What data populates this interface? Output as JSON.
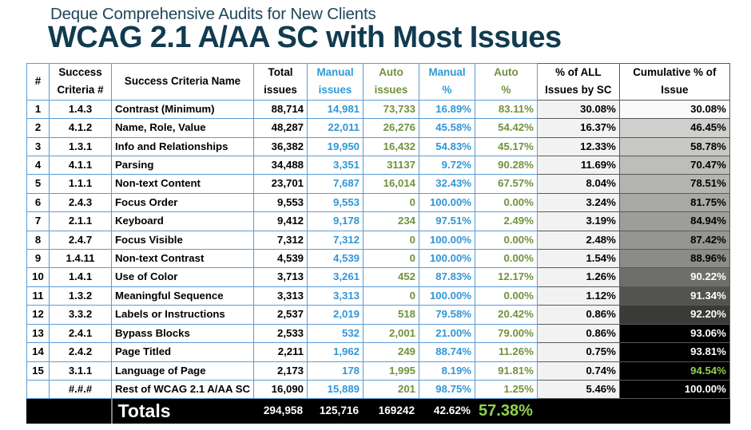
{
  "title": {
    "subtitle": "Deque Comprehensive Audits for New Clients",
    "main": "WCAG 2.1 A/AA SC with Most Issues"
  },
  "colors": {
    "title_navy": "#113b4f",
    "manual_blue": "#3196d4",
    "auto_green": "#71913d",
    "highlight_green": "#92d050",
    "grid_blue": "#5b9bd5",
    "grid_dark": "#595959"
  },
  "table": {
    "headers": [
      "#",
      "Success Criteria #",
      "Success Criteria Name",
      "Total issues",
      "Manual issues",
      "Auto issues",
      "Manual %",
      "Auto %",
      "% of ALL Issues by SC",
      "Cumulative % of Issue"
    ],
    "header_lines": [
      [
        "#",
        ""
      ],
      [
        "Success",
        "Criteria #"
      ],
      [
        "Success Criteria Name",
        ""
      ],
      [
        "Total",
        "issues"
      ],
      [
        "Manual",
        "issues"
      ],
      [
        "Auto",
        "issues"
      ],
      [
        "Manual",
        "%"
      ],
      [
        "Auto",
        "%"
      ],
      [
        "% of ALL",
        "Issues by SC"
      ],
      [
        "Cumulative % of",
        "Issue"
      ]
    ],
    "rows": [
      {
        "num": "1",
        "sc": "1.4.3",
        "name": "Contrast (Minimum)",
        "total": "88,714",
        "manual": "14,981",
        "auto": "73,733",
        "manual_pct": "16.89%",
        "auto_pct": "83.11%",
        "pct_all": "30.08%",
        "cumulative": "30.08%",
        "cum_bg": "#fafafa",
        "cum_text": "dark"
      },
      {
        "num": "2",
        "sc": "4.1.2",
        "name": "Name, Role, Value",
        "total": "48,287",
        "manual": "22,011",
        "auto": "26,276",
        "manual_pct": "45.58%",
        "auto_pct": "54.42%",
        "pct_all": "16.37%",
        "cumulative": "46.45%",
        "cum_bg": "#cfcfcd",
        "cum_text": "dark"
      },
      {
        "num": "3",
        "sc": "1.3.1",
        "name": "Info and Relationships",
        "total": "36,382",
        "manual": "19,950",
        "auto": "16,432",
        "manual_pct": "54.83%",
        "auto_pct": "45.17%",
        "pct_all": "12.33%",
        "cumulative": "58.78%",
        "cum_bg": "#c8c8c4",
        "cum_text": "dark"
      },
      {
        "num": "4",
        "sc": "4.1.1",
        "name": "Parsing",
        "total": "34,488",
        "manual": "3,351",
        "auto": "31137",
        "manual_pct": "9.72%",
        "auto_pct": "90.28%",
        "pct_all": "11.69%",
        "cumulative": "70.47%",
        "cum_bg": "#bdbdb9",
        "cum_text": "dark"
      },
      {
        "num": "5",
        "sc": "1.1.1",
        "name": "Non-text Content",
        "total": "23,701",
        "manual": "7,687",
        "auto": "16,014",
        "manual_pct": "32.43%",
        "auto_pct": "67.57%",
        "pct_all": "8.04%",
        "cumulative": "78.51%",
        "cum_bg": "#b4b4b0",
        "cum_text": "dark"
      },
      {
        "num": "6",
        "sc": "2.4.3",
        "name": "Focus Order",
        "total": "9,553",
        "manual": "9,553",
        "auto": "0",
        "manual_pct": "100.00%",
        "auto_pct": "0.00%",
        "pct_all": "3.24%",
        "cumulative": "81.75%",
        "cum_bg": "#a8a8a4",
        "cum_text": "dark"
      },
      {
        "num": "7",
        "sc": "2.1.1",
        "name": "Keyboard",
        "total": "9,412",
        "manual": "9,178",
        "auto": "234",
        "manual_pct": "97.51%",
        "auto_pct": "2.49%",
        "pct_all": "3.19%",
        "cumulative": "84.94%",
        "cum_bg": "#9d9d99",
        "cum_text": "dark"
      },
      {
        "num": "8",
        "sc": "2.4.7",
        "name": "Focus Visible",
        "total": "7,312",
        "manual": "7,312",
        "auto": "0",
        "manual_pct": "100.00%",
        "auto_pct": "0.00%",
        "pct_all": "2.48%",
        "cumulative": "87.42%",
        "cum_bg": "#959591",
        "cum_text": "dark"
      },
      {
        "num": "9",
        "sc": "1.4.11",
        "name": "Non-text Contrast",
        "total": "4,539",
        "manual": "4,539",
        "auto": "0",
        "manual_pct": "100.00%",
        "auto_pct": "0.00%",
        "pct_all": "1.54%",
        "cumulative": "88.96%",
        "cum_bg": "#8b8b87",
        "cum_text": "dark"
      },
      {
        "num": "10",
        "sc": "1.4.1",
        "name": "Use of Color",
        "total": "3,713",
        "manual": "3,261",
        "auto": "452",
        "manual_pct": "87.83%",
        "auto_pct": "12.17%",
        "pct_all": "1.26%",
        "cumulative": "90.22%",
        "cum_bg": "#6e6e6a",
        "cum_text": "white"
      },
      {
        "num": "11",
        "sc": "1.3.2",
        "name": "Meaningful Sequence",
        "total": "3,313",
        "manual": "3,313",
        "auto": "0",
        "manual_pct": "100.00%",
        "auto_pct": "0.00%",
        "pct_all": "1.12%",
        "cumulative": "91.34%",
        "cum_bg": "#53534f",
        "cum_text": "white"
      },
      {
        "num": "12",
        "sc": "3.3.2",
        "name": "Labels or Instructions",
        "total": "2,537",
        "manual": "2,019",
        "auto": "518",
        "manual_pct": "79.58%",
        "auto_pct": "20.42%",
        "pct_all": "0.86%",
        "cumulative": "92.20%",
        "cum_bg": "#3a3a36",
        "cum_text": "white"
      },
      {
        "num": "13",
        "sc": "2.4.1",
        "name": "Bypass Blocks",
        "total": "2,533",
        "manual": "532",
        "auto": "2,001",
        "manual_pct": "21.00%",
        "auto_pct": "79.00%",
        "pct_all": "0.86%",
        "cumulative": "93.06%",
        "cum_bg": "#000000",
        "cum_text": "white"
      },
      {
        "num": "14",
        "sc": "2.4.2",
        "name": "Page Titled",
        "total": "2,211",
        "manual": "1,962",
        "auto": "249",
        "manual_pct": "88.74%",
        "auto_pct": "11.26%",
        "pct_all": "0.75%",
        "cumulative": "93.81%",
        "cum_bg": "#000000",
        "cum_text": "white"
      },
      {
        "num": "15",
        "sc": "3.1.1",
        "name": "Language of Page",
        "total": "2,173",
        "manual": "178",
        "auto": "1,995",
        "manual_pct": "8.19%",
        "auto_pct": "91.81%",
        "pct_all": "0.74%",
        "cumulative": "94.54%",
        "cum_bg": "#000000",
        "cum_text": "green"
      },
      {
        "num": "",
        "sc": "#.#.#",
        "name": "Rest of WCAG 2.1 A/AA SC",
        "total": "16,090",
        "manual": "15,889",
        "auto": "201",
        "manual_pct": "98.75%",
        "auto_pct": "1.25%",
        "pct_all": "5.46%",
        "cumulative": "100.00%",
        "cum_bg": "#000000",
        "cum_text": "white"
      }
    ],
    "totals": {
      "label": "Totals",
      "total": "294,958",
      "manual": "125,716",
      "auto": "169242",
      "manual_pct": "42.62%",
      "auto_pct": "57.38%"
    }
  },
  "chart_data": {
    "type": "table",
    "title": "WCAG 2.1 A/AA SC with Most Issues",
    "subtitle": "Deque Comprehensive Audits for New Clients",
    "columns": [
      "#",
      "Success Criteria #",
      "Success Criteria Name",
      "Total issues",
      "Manual issues",
      "Auto issues",
      "Manual %",
      "Auto %",
      "% of ALL Issues by SC",
      "Cumulative % of Issue"
    ],
    "rows": [
      [
        1,
        "1.4.3",
        "Contrast (Minimum)",
        88714,
        14981,
        73733,
        16.89,
        83.11,
        30.08,
        30.08
      ],
      [
        2,
        "4.1.2",
        "Name, Role, Value",
        48287,
        22011,
        26276,
        45.58,
        54.42,
        16.37,
        46.45
      ],
      [
        3,
        "1.3.1",
        "Info and Relationships",
        36382,
        19950,
        16432,
        54.83,
        45.17,
        12.33,
        58.78
      ],
      [
        4,
        "4.1.1",
        "Parsing",
        34488,
        3351,
        31137,
        9.72,
        90.28,
        11.69,
        70.47
      ],
      [
        5,
        "1.1.1",
        "Non-text Content",
        23701,
        7687,
        16014,
        32.43,
        67.57,
        8.04,
        78.51
      ],
      [
        6,
        "2.4.3",
        "Focus Order",
        9553,
        9553,
        0,
        100.0,
        0.0,
        3.24,
        81.75
      ],
      [
        7,
        "2.1.1",
        "Keyboard",
        9412,
        9178,
        234,
        97.51,
        2.49,
        3.19,
        84.94
      ],
      [
        8,
        "2.4.7",
        "Focus Visible",
        7312,
        7312,
        0,
        100.0,
        0.0,
        2.48,
        87.42
      ],
      [
        9,
        "1.4.11",
        "Non-text Contrast",
        4539,
        4539,
        0,
        100.0,
        0.0,
        1.54,
        88.96
      ],
      [
        10,
        "1.4.1",
        "Use of Color",
        3713,
        3261,
        452,
        87.83,
        12.17,
        1.26,
        90.22
      ],
      [
        11,
        "1.3.2",
        "Meaningful Sequence",
        3313,
        3313,
        0,
        100.0,
        0.0,
        1.12,
        91.34
      ],
      [
        12,
        "3.3.2",
        "Labels or Instructions",
        2537,
        2019,
        518,
        79.58,
        20.42,
        0.86,
        92.2
      ],
      [
        13,
        "2.4.1",
        "Bypass Blocks",
        2533,
        532,
        2001,
        21.0,
        79.0,
        0.86,
        93.06
      ],
      [
        14,
        "2.4.2",
        "Page Titled",
        2211,
        1962,
        249,
        88.74,
        11.26,
        0.75,
        93.81
      ],
      [
        15,
        "3.1.1",
        "Language of Page",
        2173,
        178,
        1995,
        8.19,
        91.81,
        0.74,
        94.54
      ],
      [
        "",
        "#.#.#",
        "Rest of WCAG 2.1 A/AA SC",
        16090,
        15889,
        201,
        98.75,
        1.25,
        5.46,
        100.0
      ]
    ],
    "totals": [
      "",
      "",
      "Totals",
      294958,
      125716,
      169242,
      42.62,
      57.38,
      null,
      null
    ]
  }
}
